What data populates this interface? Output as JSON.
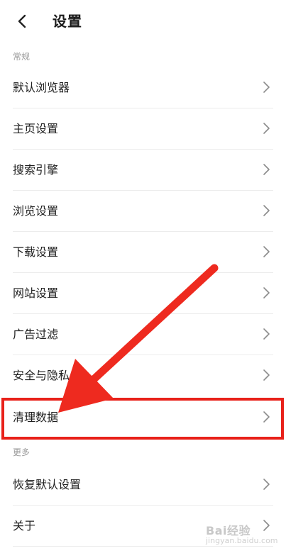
{
  "header": {
    "title": "设置",
    "back_icon": "chevron-left-icon"
  },
  "sections": [
    {
      "label": "常规",
      "items": [
        "默认浏览器",
        "主页设置",
        "搜索引擎",
        "浏览设置",
        "下载设置",
        "网站设置",
        "广告过滤",
        "安全与隐私",
        "清理数据"
      ]
    },
    {
      "label": "更多",
      "items": [
        "恢复默认设置",
        "关于"
      ]
    }
  ],
  "row_icon": "chevron-right-icon",
  "annotation": {
    "highlight_color": "#e8211a",
    "highlighted_item": "清理数据"
  },
  "watermark": {
    "text": "Bai经验",
    "sub": "jingyan.baidu.com"
  }
}
